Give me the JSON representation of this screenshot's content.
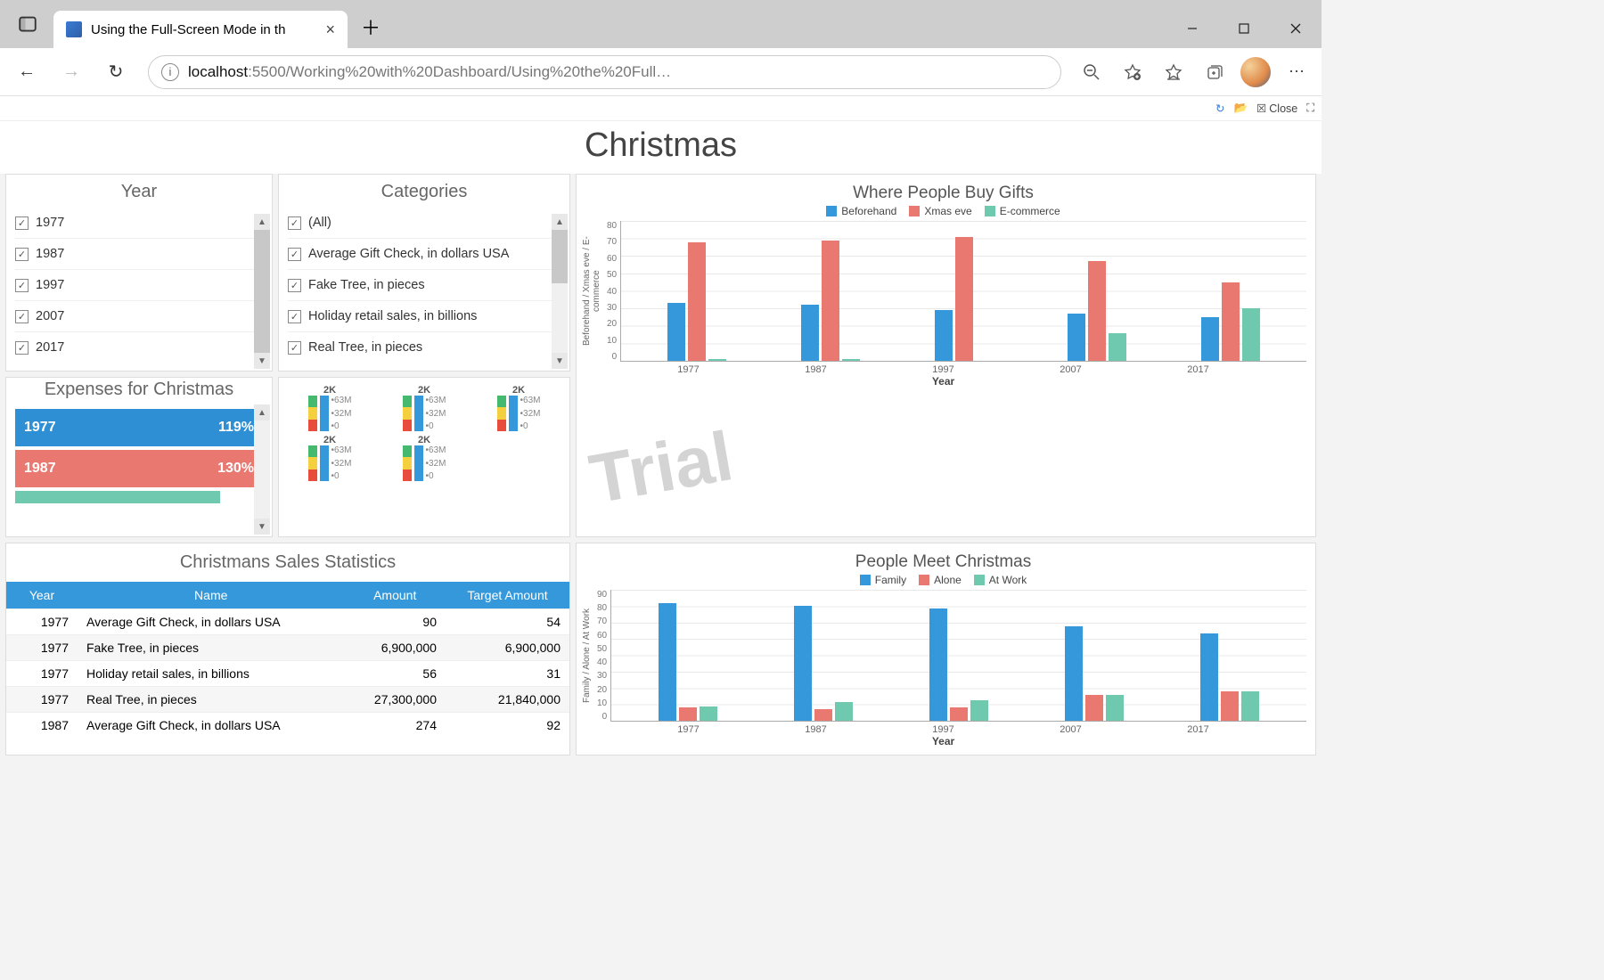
{
  "browser": {
    "tab_title": "Using the Full-Screen Mode in th",
    "url_host": "localhost",
    "url_path": ":5500/Working%20with%20Dashboard/Using%20the%20Full…"
  },
  "dash_toolbar": {
    "close": "Close"
  },
  "dashboard_title": "Christmas",
  "watermark_text": "Trial",
  "year_panel": {
    "title": "Year",
    "items": [
      "1977",
      "1987",
      "1997",
      "2007",
      "2017"
    ]
  },
  "categories_panel": {
    "title": "Categories",
    "items": [
      "(All)",
      "Average Gift Check, in dollars USA",
      "Fake Tree, in pieces",
      "Holiday retail sales, in billions",
      "Real Tree, in pieces"
    ]
  },
  "expenses_panel": {
    "title": "Expenses for Christmas",
    "rows": [
      {
        "label": "1977",
        "value": "119%",
        "color": "blue"
      },
      {
        "label": "1987",
        "value": "130%",
        "color": "red"
      }
    ]
  },
  "gauges": [
    {
      "top": "2K",
      "t1": "63M",
      "t2": "32M",
      "t3": "0"
    },
    {
      "top": "2K",
      "t1": "63M",
      "t2": "32M",
      "t3": "0"
    },
    {
      "top": "2K",
      "t1": "63M",
      "t2": "32M",
      "t3": "0"
    },
    {
      "top": "2K",
      "t1": "63M",
      "t2": "32M",
      "t3": "0"
    },
    {
      "top": "2K",
      "t1": "63M",
      "t2": "32M",
      "t3": "0"
    },
    {
      "top": "",
      "t1": "",
      "t2": "",
      "t3": ""
    }
  ],
  "chart1": {
    "title": "Where People Buy Gifts",
    "y_title": "Beforehand / Xmas eve / E-commerce",
    "x_title": "Year",
    "legend": [
      "Beforehand",
      "Xmas eve",
      "E-commerce"
    ]
  },
  "chart2": {
    "title": "People Meet Christmas",
    "y_title": "Family / Alone / At Work",
    "x_title": "Year",
    "legend": [
      "Family",
      "Alone",
      "At Work"
    ]
  },
  "table": {
    "title": "Christmans Sales Statistics",
    "headers": [
      "Year",
      "Name",
      "Amount",
      "Target Amount"
    ],
    "rows": [
      [
        "1977",
        "Average Gift Check, in dollars USA",
        "90",
        "54"
      ],
      [
        "1977",
        "Fake Tree, in pieces",
        "6,900,000",
        "6,900,000"
      ],
      [
        "1977",
        "Holiday retail sales, in billions",
        "56",
        "31"
      ],
      [
        "1977",
        "Real Tree, in pieces",
        "27,300,000",
        "21,840,000"
      ],
      [
        "1987",
        "Average Gift Check, in dollars USA",
        "274",
        "92"
      ]
    ]
  },
  "chart_data": [
    {
      "type": "bar",
      "title": "Where People Buy Gifts",
      "xlabel": "Year",
      "ylabel": "Beforehand / Xmas eve / E-commerce",
      "ylim": [
        0,
        80
      ],
      "categories": [
        "1977",
        "1987",
        "1997",
        "2007",
        "2017"
      ],
      "series": [
        {
          "name": "Beforehand",
          "values": [
            33,
            32,
            29,
            27,
            25
          ]
        },
        {
          "name": "Xmas eve",
          "values": [
            68,
            69,
            71,
            57,
            45
          ]
        },
        {
          "name": "E-commerce",
          "values": [
            1,
            1,
            0,
            16,
            30
          ]
        }
      ]
    },
    {
      "type": "bar",
      "title": "People Meet Christmas",
      "xlabel": "Year",
      "ylabel": "Family / Alone / At Work",
      "ylim": [
        0,
        90
      ],
      "categories": [
        "1977",
        "1987",
        "1997",
        "2007",
        "2017"
      ],
      "series": [
        {
          "name": "Family",
          "values": [
            81,
            79,
            77,
            65,
            60
          ]
        },
        {
          "name": "Alone",
          "values": [
            9,
            8,
            9,
            18,
            20
          ]
        },
        {
          "name": "At Work",
          "values": [
            10,
            13,
            14,
            18,
            20
          ]
        }
      ]
    }
  ]
}
